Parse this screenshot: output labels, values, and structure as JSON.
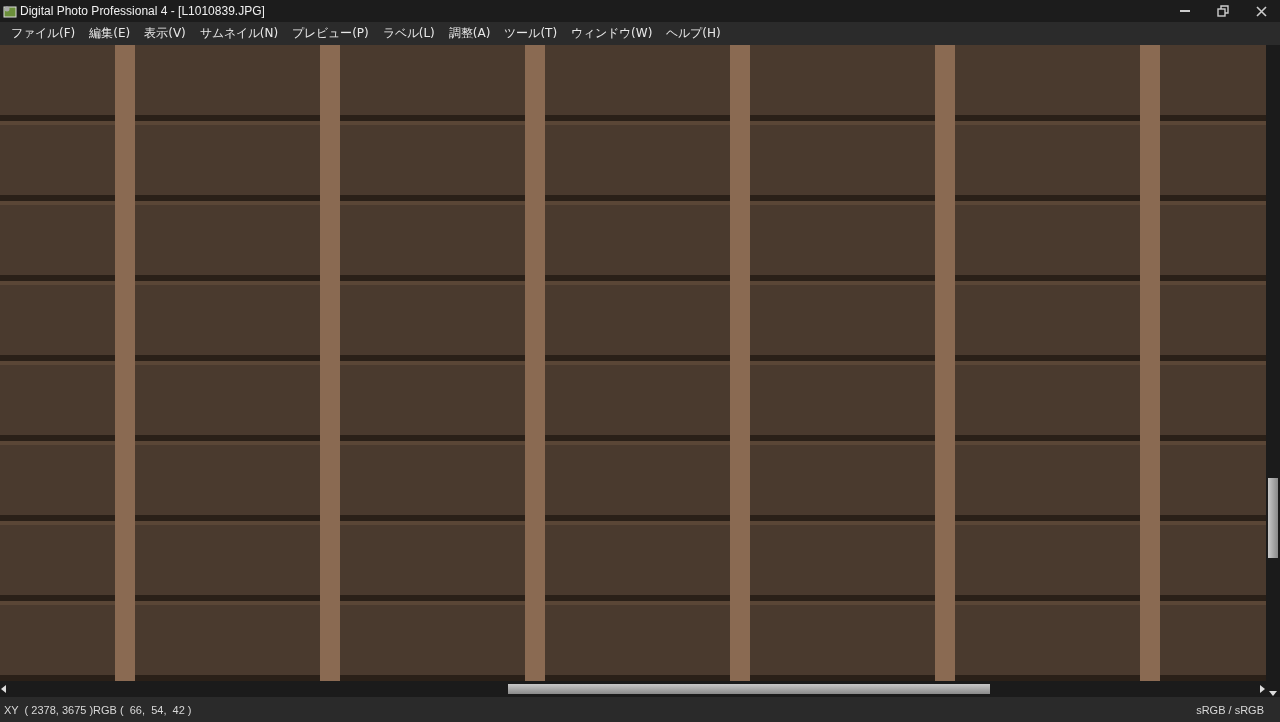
{
  "window": {
    "title": "Digital Photo Professional 4 - [L1010839.JPG]"
  },
  "menu": [
    "ファイル(F)",
    "編集(E)",
    "表示(V)",
    "サムネイル(N)",
    "プレビュー(P)",
    "ラベル(L)",
    "調整(A)",
    "ツール(T)",
    "ウィンドウ(W)",
    "ヘルプ(H)"
  ],
  "status_bar": {
    "position": "XY  ( 2378, 3675 )RGB (  66,  54,  42 )",
    "color_space": "sRGB / sRGB"
  }
}
